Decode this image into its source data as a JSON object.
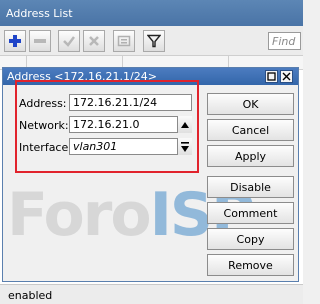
{
  "list_window": {
    "title": "Address List",
    "find_placeholder": "Find",
    "status": "enabled",
    "toolbar_icons": [
      "plus-icon",
      "minus-icon",
      "check-icon",
      "cross-icon",
      "comment-icon",
      "filter-icon"
    ]
  },
  "dialog": {
    "title": "Address <172.16.21.1/24>",
    "fields": {
      "address_label": "Address:",
      "address_value": "172.16.21.1/24",
      "network_label": "Network:",
      "network_value": "172.16.21.0",
      "interface_label": "Interface:",
      "interface_value": "vlan301"
    },
    "buttons": {
      "ok": "OK",
      "cancel": "Cancel",
      "apply": "Apply",
      "disable": "Disable",
      "comment": "Comment",
      "copy": "Copy",
      "remove": "Remove"
    },
    "watermark": {
      "part1": "Foro",
      "part2": "ISP"
    },
    "colors": {
      "highlight": "#e1232c",
      "title_bar": "#3366aa",
      "plus": "#1f44c8"
    }
  }
}
